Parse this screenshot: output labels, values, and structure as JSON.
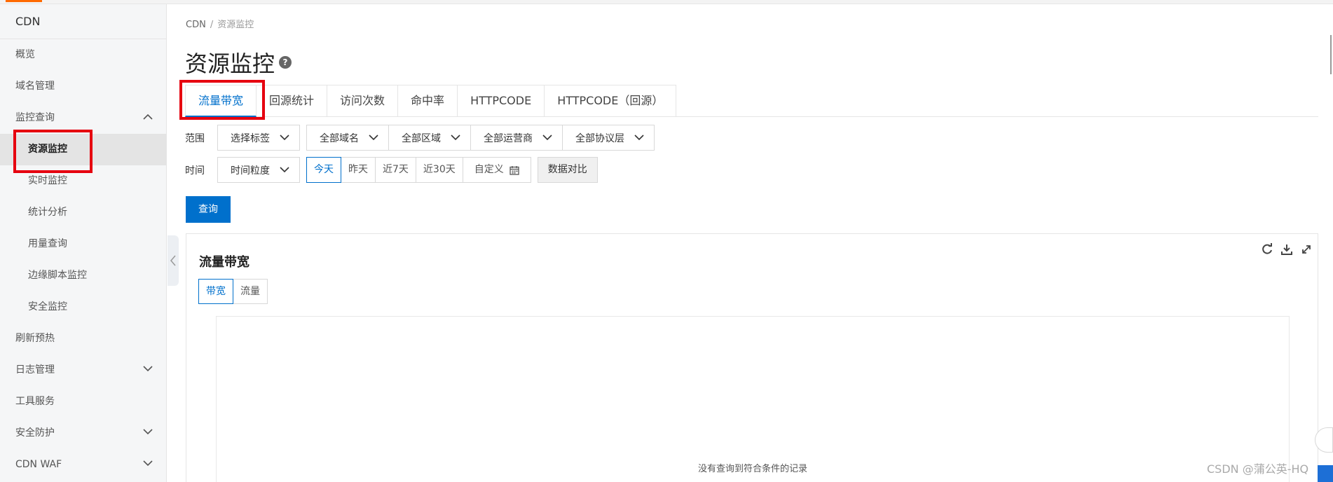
{
  "sidebar": {
    "title": "CDN",
    "items": [
      {
        "label": "概览"
      },
      {
        "label": "域名管理"
      },
      {
        "label": "监控查询"
      },
      {
        "label": "资源监控"
      },
      {
        "label": "实时监控"
      },
      {
        "label": "统计分析"
      },
      {
        "label": "用量查询"
      },
      {
        "label": "边缘脚本监控"
      },
      {
        "label": "安全监控"
      },
      {
        "label": "刷新预热"
      },
      {
        "label": "日志管理"
      },
      {
        "label": "工具服务"
      },
      {
        "label": "安全防护"
      },
      {
        "label": "CDN WAF"
      }
    ]
  },
  "breadcrumb": {
    "root": "CDN",
    "sep": "/",
    "current": "资源监控"
  },
  "page": {
    "title": "资源监控",
    "help": "?"
  },
  "tabs": [
    {
      "label": "流量带宽"
    },
    {
      "label": "回源统计"
    },
    {
      "label": "访问次数"
    },
    {
      "label": "命中率"
    },
    {
      "label": "HTTPCODE"
    },
    {
      "label": "HTTPCODE（回源）"
    }
  ],
  "filters": {
    "scope_label": "范围",
    "scope": [
      "选择标签",
      "全部域名",
      "全部区域",
      "全部运营商",
      "全部协议层"
    ],
    "time_label": "时间",
    "granularity": "时间粒度",
    "ranges": [
      "今天",
      "昨天",
      "近7天",
      "近30天",
      "自定义"
    ],
    "compare": "数据对比"
  },
  "query_button": "查询",
  "panel": {
    "title": "流量带宽",
    "subtabs": [
      "带宽",
      "流量"
    ],
    "empty_message": "没有查询到符合条件的记录"
  },
  "watermark": "CSDN @蒲公英-HQ",
  "colors": {
    "accent": "#0070cc",
    "highlight_box": "#e6000f",
    "brand": "#ff6a00"
  }
}
